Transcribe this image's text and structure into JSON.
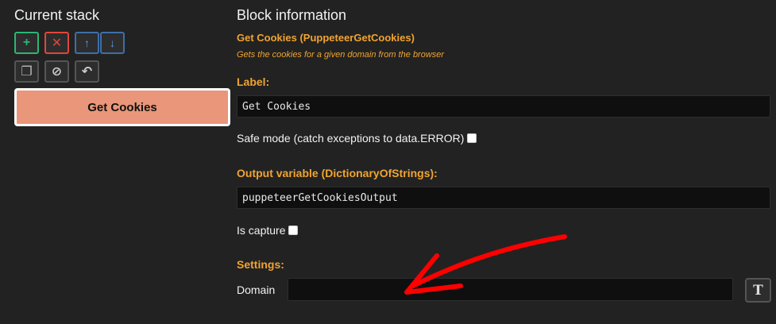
{
  "left_panel": {
    "title": "Current stack",
    "toolbar": {
      "add_icon": "+",
      "delete_icon": "✕",
      "up_icon": "↑",
      "down_icon": "↓",
      "copy_icon": "❐",
      "disable_icon": "⊘",
      "undo_icon": "↶"
    },
    "stack_items": [
      "Get Cookies"
    ]
  },
  "right_panel": {
    "title": "Block information",
    "block_name": "Get Cookies (PuppeteerGetCookies)",
    "block_description": "Gets the cookies for a given domain from the browser",
    "label_heading": "Label:",
    "label_value": "Get Cookies",
    "safe_mode_label": "Safe mode (catch exceptions to data.ERROR)",
    "output_heading": "Output variable (DictionaryOfStrings):",
    "output_value": "puppeteerGetCookiesOutput",
    "capture_label": "Is capture",
    "settings_heading": "Settings:",
    "domain_label": "Domain",
    "domain_value": "",
    "type_button_icon": "T"
  },
  "colors": {
    "accent": "#f0a431",
    "stack_item": "#e9967a",
    "annotation": "#ff0000"
  }
}
